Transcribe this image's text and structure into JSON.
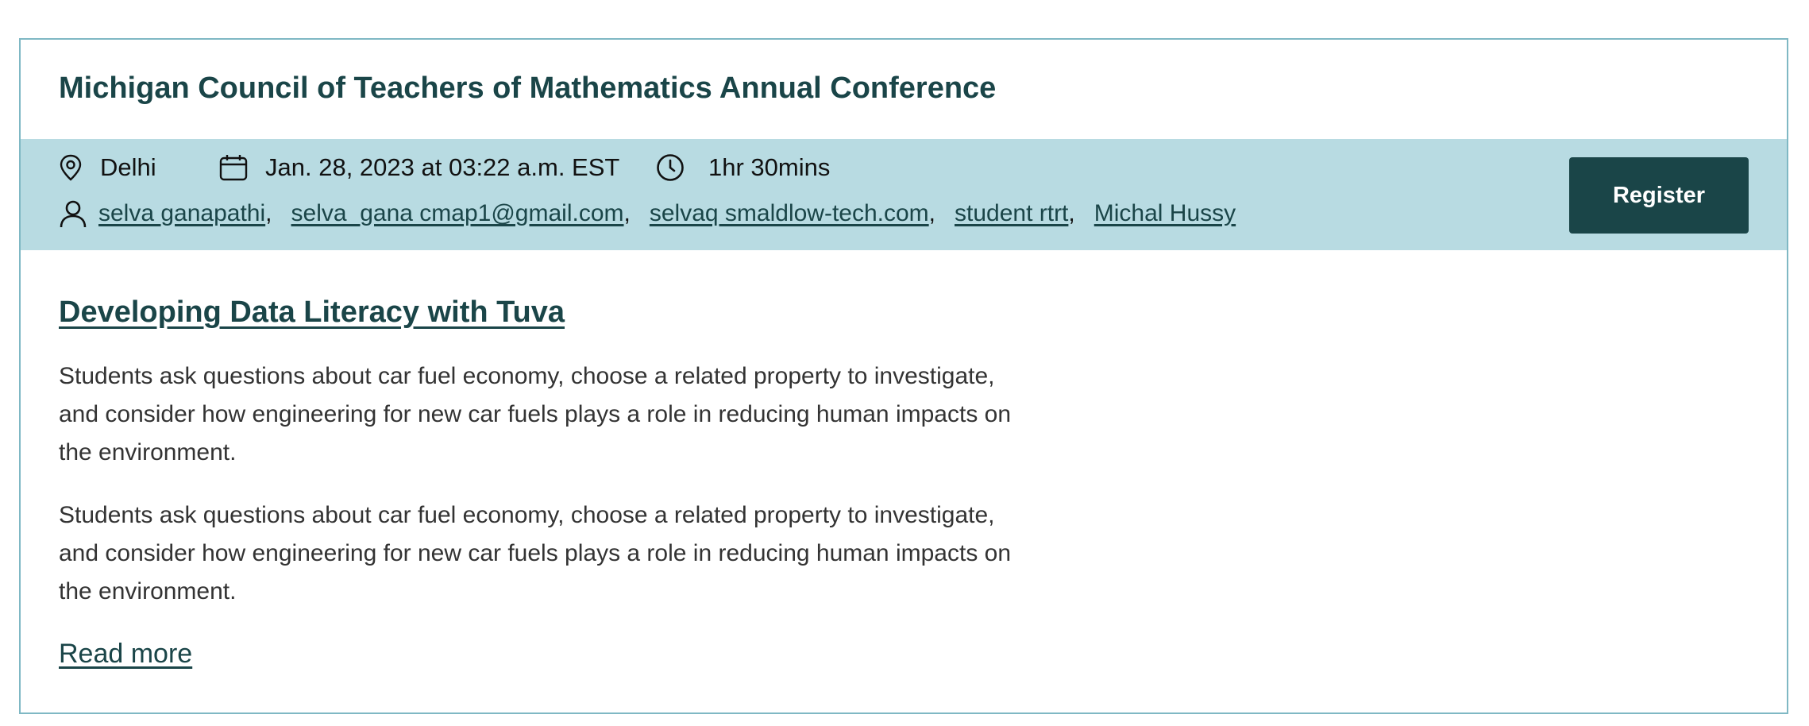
{
  "event": {
    "title": "Michigan Council of Teachers of Mathematics Annual Conference"
  },
  "meta": {
    "location": "Delhi",
    "date": "Jan. 28, 2023 at 03:22 a.m. EST",
    "duration": "1hr 30mins",
    "location_icon": "location-pin-icon",
    "date_icon": "calendar-icon",
    "duration_icon": "clock-icon",
    "presenters_icon": "person-icon"
  },
  "presenters": [
    "selva ganapathi",
    "selva_gana cmap1@gmail.com",
    "selvaq smaldlow-tech.com",
    "student rtrt",
    "Michal Hussy"
  ],
  "separator": ",",
  "register_label": "Register",
  "session": {
    "title": "Developing Data Literacy with Tuva",
    "description_1": "Students ask questions about car fuel economy, choose a related property to investigate, and consider how engineering for new car fuels plays a role in reducing human impacts on the environment.",
    "description_2": "Students ask questions about car fuel economy, choose a related property to investigate, and consider how engineering for new car fuels plays a role in reducing human impacts on the environment.",
    "read_more": "Read more"
  },
  "colors": {
    "primary": "#1a4548",
    "meta_bar_bg": "#b8dbe2",
    "card_border": "#7fb8c4"
  }
}
